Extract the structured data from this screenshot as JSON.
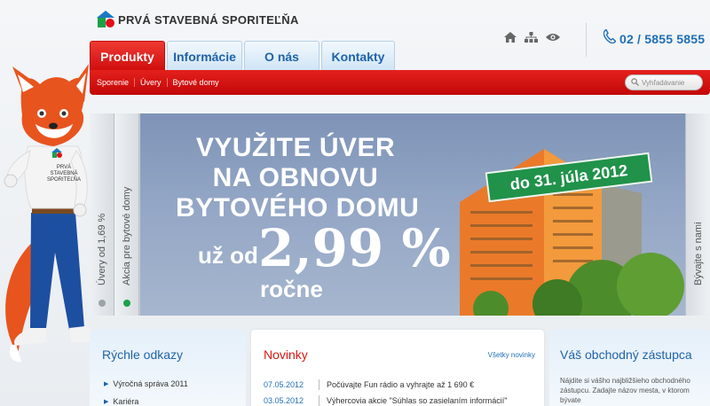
{
  "header": {
    "logo_text": "PRVÁ STAVEBNÁ SPORITEĽŇA",
    "phone": "02 / 5855 5855",
    "icons": [
      "home-icon",
      "sitemap-icon",
      "eye-icon",
      "phone-icon"
    ]
  },
  "nav": {
    "tabs": [
      {
        "label": "Produkty",
        "active": true
      },
      {
        "label": "Informácie",
        "active": false
      },
      {
        "label": "O nás",
        "active": false
      },
      {
        "label": "Kontakty",
        "active": false
      }
    ],
    "subnav": [
      "Sporenie",
      "Úvery",
      "Bytové domy"
    ],
    "search_placeholder": "Vyhľadávanie"
  },
  "mascot": {
    "shirt_text": [
      "PRVÁ STAVEBNÁ",
      "SPORITEĽŇA"
    ]
  },
  "banner": {
    "left_tabs": [
      "Úvery od 1,69 %",
      "Akcia pre bytové domy"
    ],
    "right_tab": "Bývajte s nami",
    "headline": [
      "VYUŽITE ÚVER",
      "NA OBNOVU",
      "BYTOVÉHO DOMU"
    ],
    "rate_prefix": "už od",
    "rate_value": "2,99 %",
    "rate_suffix": "ročne",
    "deadline": "do 31. júla 2012"
  },
  "quick_links": {
    "title": "Rýchle odkazy",
    "items": [
      "Výročná správa 2011",
      "Kariéra"
    ]
  },
  "news": {
    "title": "Novinky",
    "all_link": "Všetky novinky",
    "items": [
      {
        "date": "07.05.2012",
        "text": "Počúvajte Fun rádio a vyhrajte až 1 690 €"
      },
      {
        "date": "03.05.2012",
        "text": "Výhercovia akcie \"Súhlas so zasielaním informácií\""
      }
    ]
  },
  "agent": {
    "title": "Váš obchodný zástupca",
    "text": "Nájdite si vášho najbližšieho obchodného zástupcu. Zadajte názov mesta, v ktorom bývate"
  },
  "colors": {
    "brand_red": "#d81a12",
    "brand_blue": "#1f63a7",
    "brand_green": "#1aa14a"
  }
}
